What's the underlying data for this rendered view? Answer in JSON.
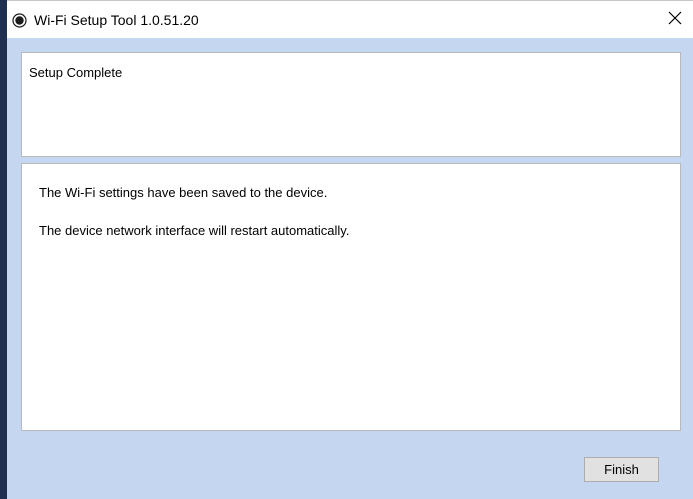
{
  "window": {
    "title": "Wi-Fi Setup Tool 1.0.51.20",
    "close_glyph": "✕"
  },
  "header": {
    "title": "Setup Complete"
  },
  "body": {
    "messages": [
      "The Wi-Fi settings have been saved to the device.",
      "The device network interface will restart automatically."
    ]
  },
  "footer": {
    "finish_label": "Finish"
  },
  "colors": {
    "client_background": "#c5d7f0",
    "left_edge": "#1f2f4f",
    "button_background": "#e1e1e1"
  },
  "icons": {
    "app": "app-icon",
    "close": "close-icon"
  }
}
